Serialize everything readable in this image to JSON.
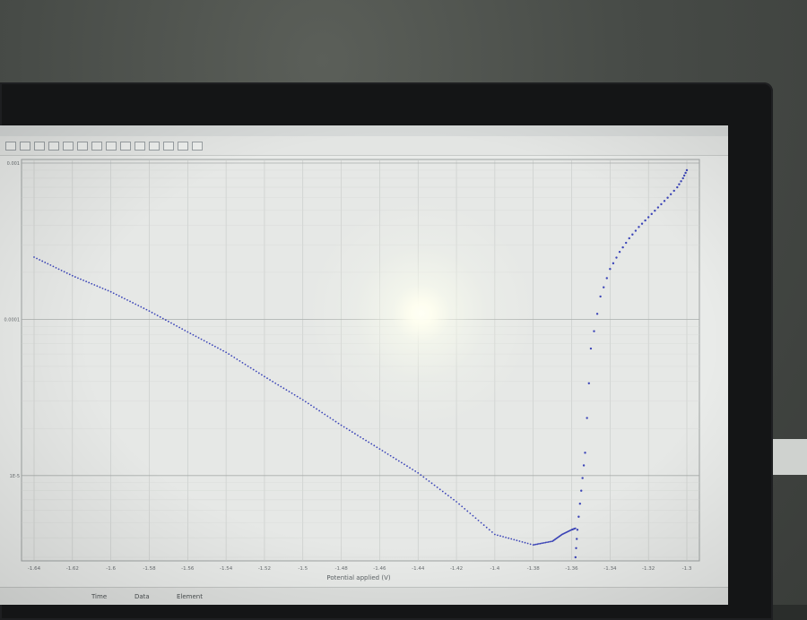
{
  "window": {
    "toolbar_icons": [
      "save-icon",
      "open-icon",
      "print-icon",
      "copy-icon",
      "zoom-icon",
      "pan-icon",
      "cursor-icon",
      "grid-icon",
      "scale-icon",
      "legend-icon",
      "export-icon",
      "settings-icon",
      "refresh-icon",
      "help-icon"
    ]
  },
  "status_bar": {
    "time_label": "Time",
    "data_label": "Data",
    "element_label": "Element"
  },
  "colors": {
    "series": "#3c45b8",
    "grid": "#c6c9c7",
    "plot_bg": "#e6e8e6",
    "axis_text": "#6a6f72"
  },
  "chart_data": {
    "type": "scatter",
    "xlabel": "Potential applied (V)",
    "ylabel": "",
    "x_ticks": [
      "-1.64",
      "-1.62",
      "-1.6",
      "-1.58",
      "-1.56",
      "-1.54",
      "-1.52",
      "-1.5",
      "-1.48",
      "-1.46",
      "-1.44",
      "-1.42",
      "-1.4",
      "-1.38",
      "-1.36",
      "-1.34",
      "-1.32",
      "-1.3"
    ],
    "y_ticks": [
      "0.001",
      "0.0001",
      "1E-5"
    ],
    "y_scale": "log",
    "xlim": [
      -1.64,
      -1.3
    ],
    "ylim": [
      3e-06,
      0.001
    ],
    "grid": true,
    "series": [
      {
        "x": [
          -1.64,
          -1.62,
          -1.6,
          -1.58,
          -1.56,
          -1.54,
          -1.52,
          -1.5,
          -1.48,
          -1.46,
          -1.44,
          -1.42,
          -1.4,
          -1.38,
          -1.37,
          -1.365,
          -1.36,
          -1.358
        ],
        "y": [
          0.00025,
          0.00019,
          0.00015,
          0.000113,
          8.3e-05,
          6.15e-05,
          4.3e-05,
          3.05e-05,
          2.1e-05,
          1.48e-05,
          1.04e-05,
          6.8e-06,
          4.2e-06,
          3.6e-06,
          3.8e-06,
          4.2e-06,
          4.5e-06,
          4.6e-06
        ]
      },
      {
        "x": [
          -1.358,
          -1.357,
          -1.355,
          -1.353,
          -1.35,
          -1.345,
          -1.34,
          -1.335,
          -1.33,
          -1.325,
          -1.32,
          -1.315,
          -1.31,
          -1.305,
          -1.302,
          -1.3
        ],
        "y": [
          3e-06,
          4.5e-06,
          8e-06,
          1.4e-05,
          6.5e-05,
          0.00014,
          0.00021,
          0.00027,
          0.00033,
          0.00039,
          0.00045,
          0.00052,
          0.0006,
          0.0007,
          0.0008,
          0.0009
        ]
      }
    ]
  }
}
